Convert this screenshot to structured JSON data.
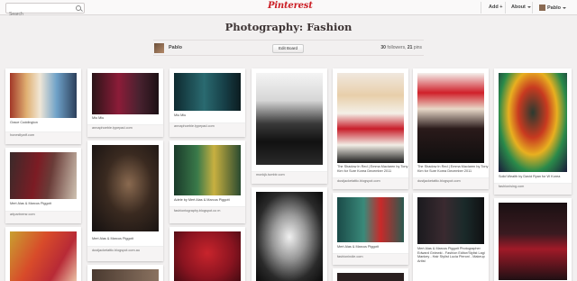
{
  "topbar": {
    "search_placeholder": "Search",
    "logo": "Pinterest",
    "add_label": "Add +",
    "about_label": "About",
    "user_label": "Pablo"
  },
  "board": {
    "title": "Photography: Fashion",
    "owner": "Pablo",
    "edit_label": "Edit Board",
    "followers_count": "30",
    "followers_label": "followers",
    "pins_count": "21",
    "pins_label": "pins"
  },
  "colors": {
    "brand_red": "#cb2027",
    "background": "#f2f0f0"
  },
  "pins": [
    {
      "caption": "Grace Coddington",
      "source": "honestlywtf.com"
    },
    {
      "caption": "Miu Miu",
      "source": "annaphoebie.typepad.com"
    },
    {
      "caption": "Miu Miu",
      "source": "annaphoebie.typepad.com"
    },
    {
      "caption": "",
      "source": "monkjk.tumblr.com"
    },
    {
      "caption": "The Shadow In Red | Emma Maclaren by Tony Kim for Sure Korea December 2011",
      "source": "dustjacketattic.blogspot.com"
    },
    {
      "caption": "The Shadow In Red | Emma Maclaren by Tony Kim for Sure Korea December 2011",
      "source": "dustjacketattic.blogspot.com"
    },
    {
      "caption": "Solid Wealth by David Ryan for W Korea",
      "source": "fashionising.com"
    },
    {
      "caption": "Mert Alas & Marcus Piggott",
      "source": "artpartnersr.com"
    },
    {
      "caption": "Adele by Mert Alas & Marcus Piggott",
      "source": "fashiontography.blogspot.co m"
    },
    {
      "caption": "Mert Alas & Marcus Piggott",
      "source": "dustjacketattic.blogspot.com.au"
    },
    {
      "caption": "Mert Alas & Marcus Piggott",
      "source": "fashionindie.com"
    },
    {
      "caption": "Mert Alas & Marcus Piggott Photographer Edward Gniewki - Fashion Editor/Stylist Lagi Mankey - Hair Stylist Lucia Pieroni - Makeup Artist",
      "source": ""
    },
    {
      "caption": "",
      "source": ""
    },
    {
      "caption": "",
      "source": ""
    },
    {
      "caption": "",
      "source": ""
    },
    {
      "caption": "",
      "source": ""
    },
    {
      "caption": "",
      "source": ""
    }
  ]
}
